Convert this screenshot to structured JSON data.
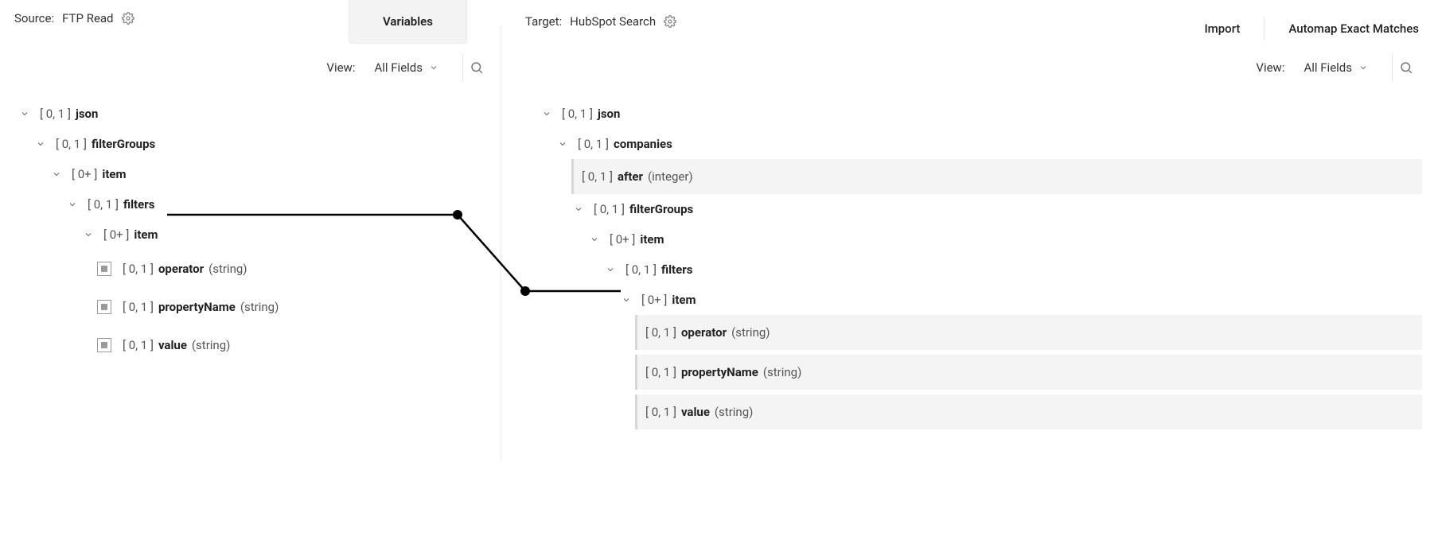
{
  "header": {
    "source_label": "Source:",
    "source_name": "FTP Read",
    "variables_tab": "Variables",
    "target_label": "Target:",
    "target_name": "HubSpot Search",
    "import_btn": "Import",
    "automap_btn": "Automap Exact Matches"
  },
  "toolbar": {
    "view_label": "View:",
    "view_value": "All Fields"
  },
  "source_tree": {
    "n0": {
      "card": "[ 0, 1 ]",
      "name": "json"
    },
    "n1": {
      "card": "[ 0, 1 ]",
      "name": "filterGroups"
    },
    "n2": {
      "card": "[ 0+ ]",
      "name": "item"
    },
    "n3": {
      "card": "[ 0, 1 ]",
      "name": "filters"
    },
    "n4": {
      "card": "[ 0+ ]",
      "name": "item"
    },
    "n5": {
      "card": "[ 0, 1 ]",
      "name": "operator",
      "type": "(string)"
    },
    "n6": {
      "card": "[ 0, 1 ]",
      "name": "propertyName",
      "type": "(string)"
    },
    "n7": {
      "card": "[ 0, 1 ]",
      "name": "value",
      "type": "(string)"
    }
  },
  "target_tree": {
    "t0": {
      "card": "[ 0, 1 ]",
      "name": "json"
    },
    "t1": {
      "card": "[ 0, 1 ]",
      "name": "companies"
    },
    "t2": {
      "card": "[ 0, 1 ]",
      "name": "after",
      "type": "(integer)"
    },
    "t3": {
      "card": "[ 0, 1 ]",
      "name": "filterGroups"
    },
    "t4": {
      "card": "[ 0+ ]",
      "name": "item"
    },
    "t5": {
      "card": "[ 0, 1 ]",
      "name": "filters"
    },
    "t6": {
      "card": "[ 0+ ]",
      "name": "item"
    },
    "t7": {
      "card": "[ 0, 1 ]",
      "name": "operator",
      "type": "(string)"
    },
    "t8": {
      "card": "[ 0, 1 ]",
      "name": "propertyName",
      "type": "(string)"
    },
    "t9": {
      "card": "[ 0, 1 ]",
      "name": "value",
      "type": "(string)"
    }
  }
}
